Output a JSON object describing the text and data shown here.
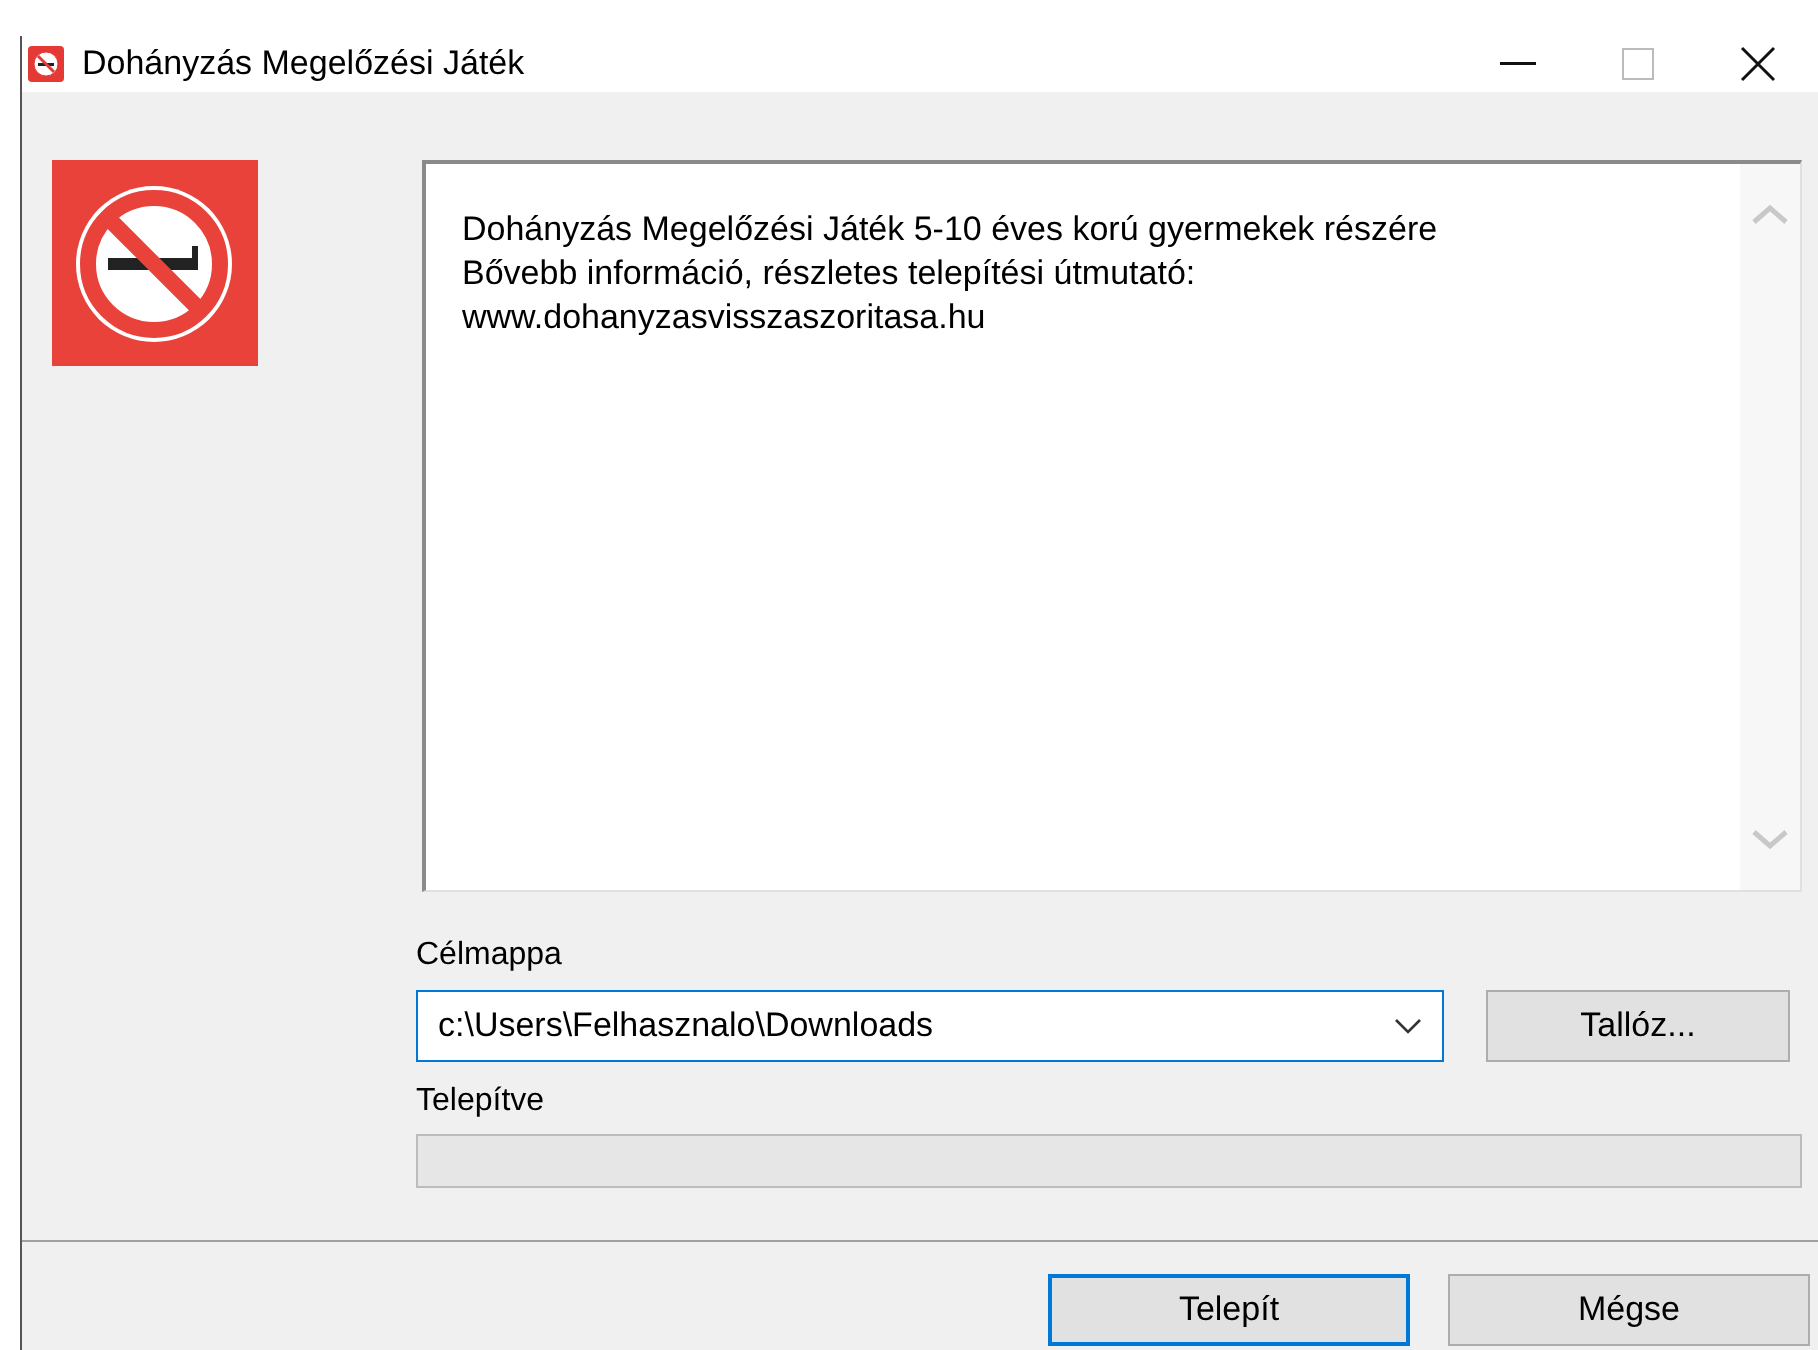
{
  "window": {
    "title": "Dohányzás Megelőzési Játék"
  },
  "info_text": [
    "Dohányzás Megelőzési Játék 5-10 éves korú gyermekek részére",
    "Bővebb információ, részletes telepítési útmutató:",
    "www.dohanyzasvisszaszoritasa.hu"
  ],
  "target_folder": {
    "label": "Célmappa",
    "value": "c:\\Users\\Felhasznalo\\Downloads",
    "focused": true,
    "browse_button": "Tallóz..."
  },
  "progress": {
    "label": "Telepítve",
    "level": 0
  },
  "buttons": [
    {
      "label": "Telepít",
      "default": true
    },
    {
      "label": "Mégse",
      "default": false
    }
  ]
}
